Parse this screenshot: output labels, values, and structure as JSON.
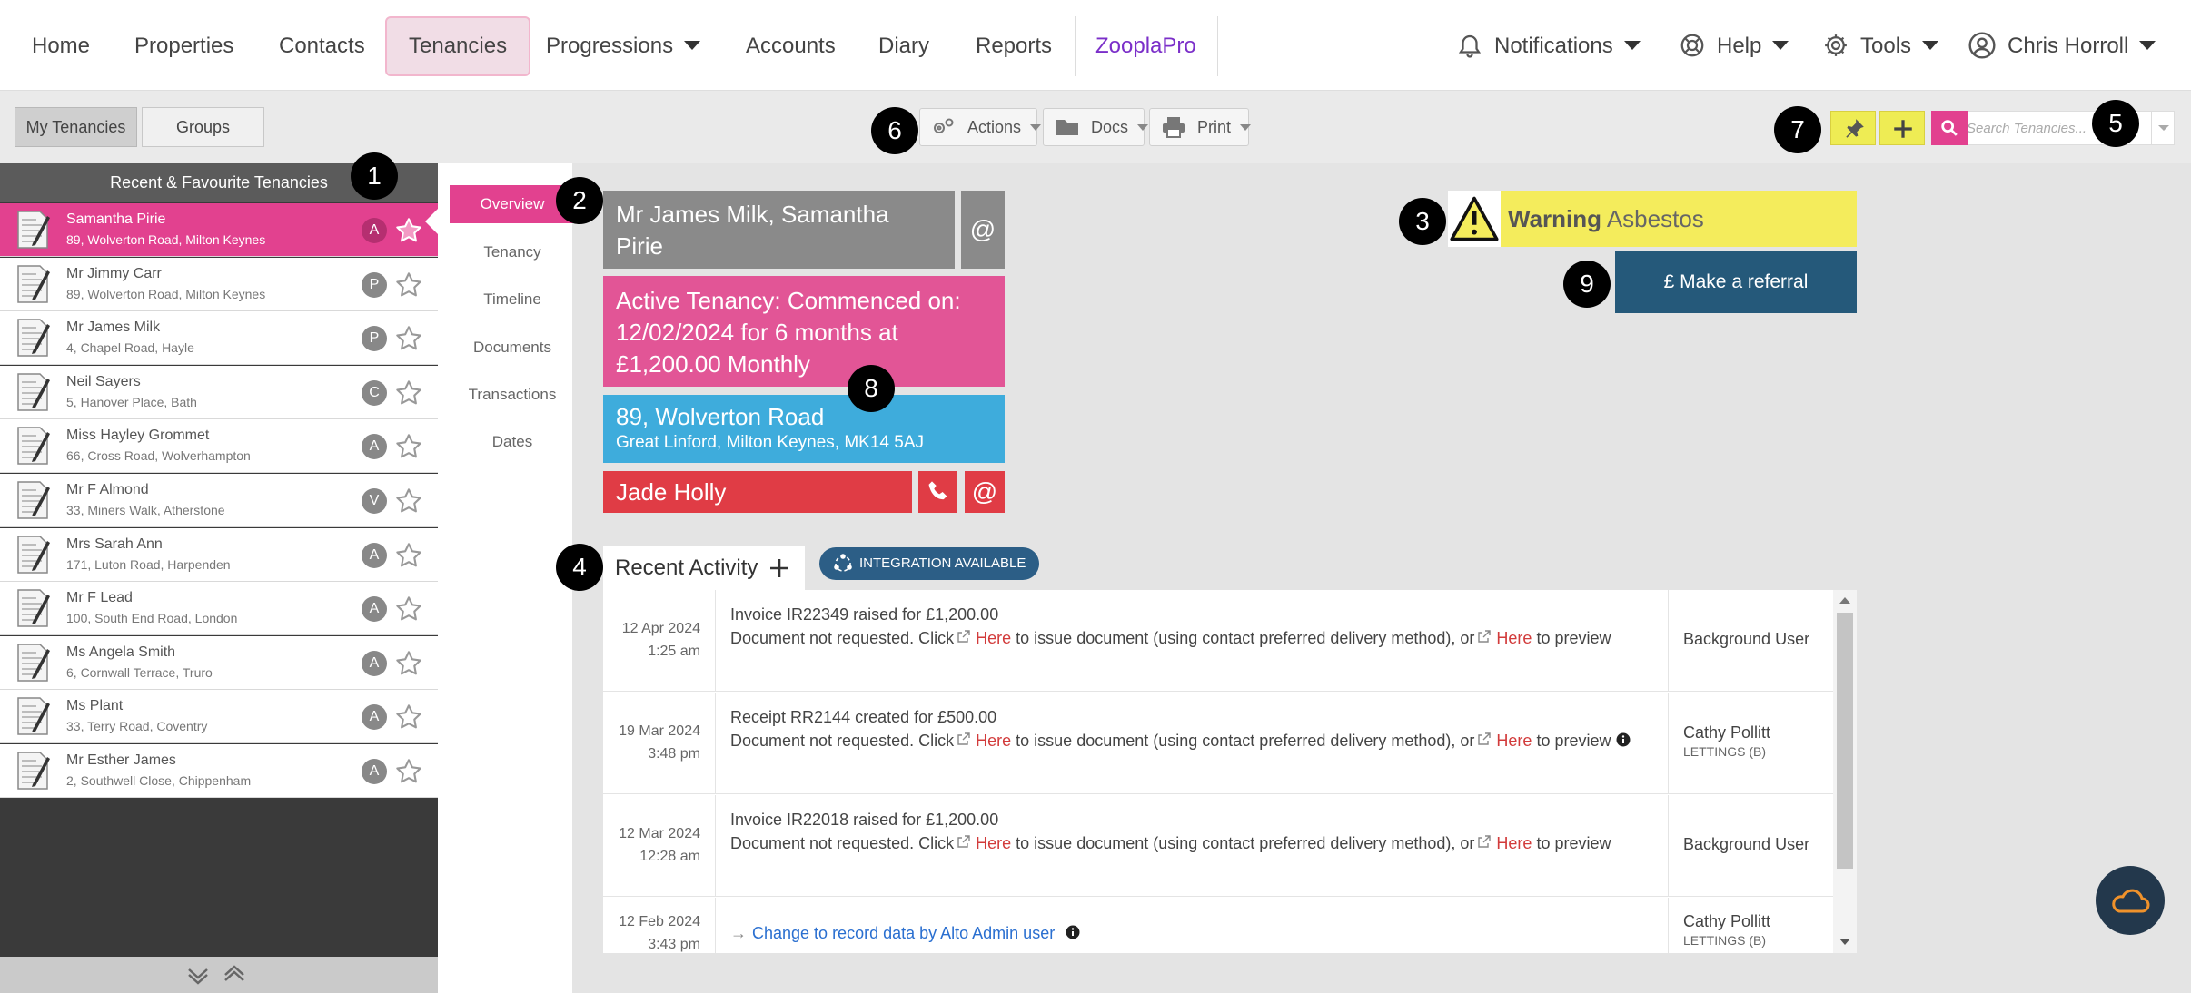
{
  "nav": {
    "items": [
      {
        "label": "Home"
      },
      {
        "label": "Properties"
      },
      {
        "label": "Contacts"
      },
      {
        "label": "Tenancies"
      },
      {
        "label": "Progressions"
      },
      {
        "label": "Accounts"
      },
      {
        "label": "Diary"
      },
      {
        "label": "Reports"
      },
      {
        "label": "ZooplaPro"
      }
    ],
    "notifications": "Notifications",
    "help": "Help",
    "tools": "Tools",
    "user": "Chris Horroll"
  },
  "toolbar": {
    "my_tenancies": "My Tenancies",
    "groups": "Groups",
    "actions": "Actions",
    "docs": "Docs",
    "print": "Print",
    "search_placeholder": "Search Tenancies..."
  },
  "badges": [
    "1",
    "2",
    "3",
    "4",
    "5",
    "6",
    "7",
    "8",
    "9"
  ],
  "sidebar": {
    "header": "Recent & Favourite Tenancies",
    "items": [
      {
        "name": "Samantha Pirie",
        "address": "89, Wolverton Road, Milton Keynes",
        "status": "A"
      },
      {
        "name": "Mr Jimmy Carr",
        "address": "89, Wolverton Road, Milton Keynes",
        "status": "P"
      },
      {
        "name": "Mr James Milk",
        "address": "4, Chapel Road, Hayle",
        "status": "P"
      },
      {
        "name": "Neil Sayers",
        "address": "5, Hanover Place, Bath",
        "status": "C"
      },
      {
        "name": "Miss Hayley Grommet",
        "address": "66, Cross Road, Wolverhampton",
        "status": "A"
      },
      {
        "name": "Mr F Almond",
        "address": "33, Miners Walk, Atherstone",
        "status": "V"
      },
      {
        "name": "Mrs Sarah Ann",
        "address": "171, Luton Road, Harpenden",
        "status": "A"
      },
      {
        "name": "Mr F Lead",
        "address": "100, South End Road, London",
        "status": "A"
      },
      {
        "name": "Ms Angela Smith",
        "address": "6, Cornwall Terrace, Truro",
        "status": "A"
      },
      {
        "name": "Ms Plant",
        "address": "33, Terry Road, Coventry",
        "status": "A"
      },
      {
        "name": "Mr Esther James",
        "address": "2, Southwell Close, Chippenham",
        "status": "A"
      }
    ]
  },
  "subnav": [
    "Overview",
    "Tenancy",
    "Timeline",
    "Documents",
    "Transactions",
    "Dates"
  ],
  "overview": {
    "tenants": "Mr James Milk, Samantha Pirie",
    "email_symbol": "@",
    "status": "Active Tenancy: Commenced on: 12/02/2024 for 6 months at £1,200.00 Monthly",
    "address_line1": "89, Wolverton Road",
    "address_line2": "Great Linford, Milton Keynes, MK14 5AJ",
    "negotiator": "Jade Holly",
    "warning_label": "Warning",
    "warning_text": "Asbestos",
    "referral": "£ Make a referral"
  },
  "activity": {
    "title": "Recent Activity",
    "integration": "INTEGRATION AVAILABLE",
    "rows": [
      {
        "date": "12 Apr 2024",
        "time": "1:25 am",
        "line1": "Invoice IR22349 raised for £1,200.00",
        "pre": "Document not requested. Click",
        "here1": "Here",
        "mid": "to issue document (using contact preferred delivery method), or",
        "here2": "Here",
        "post": "to preview",
        "user": "Background User",
        "user_sub": ""
      },
      {
        "date": "19 Mar 2024",
        "time": "3:48 pm",
        "line1": "Receipt RR2144 created for £500.00",
        "pre": "Document not requested. Click",
        "here1": "Here",
        "mid": "to issue document (using contact preferred delivery method), or",
        "here2": "Here",
        "post": "to preview",
        "user": "Cathy Pollitt",
        "user_sub": "LETTINGS (B)"
      },
      {
        "date": "12 Mar 2024",
        "time": "12:28 am",
        "line1": "Invoice IR22018 raised for £1,200.00",
        "pre": "Document not requested. Click",
        "here1": "Here",
        "mid": "to issue document (using contact preferred delivery method), or",
        "here2": "Here",
        "post": "to preview",
        "user": "Background User",
        "user_sub": ""
      },
      {
        "date": "12 Feb 2024",
        "time": "3:43 pm",
        "link": "Change to record data by Alto Admin user",
        "user": "Cathy Pollitt",
        "user_sub": "LETTINGS (B)"
      }
    ]
  },
  "colors": {
    "accent_pink": "#e2418f",
    "tenancy_status": "#e25596",
    "address_blue": "#3eacdc",
    "negotiator_red": "#e03c45",
    "warning_yellow": "#f4ec5c",
    "referral_blue": "#25597a",
    "zoopla_purple": "#7b2fc9"
  },
  "icons": {
    "notifications": "bell-icon",
    "help": "lifebuoy-icon",
    "tools": "gear-icon",
    "user": "user-circle-icon",
    "actions": "gears-icon",
    "docs": "folder-icon",
    "print": "printer-icon",
    "pin": "pin-icon",
    "add": "plus-icon",
    "search": "search-icon",
    "cloud": "cloud-icon"
  }
}
